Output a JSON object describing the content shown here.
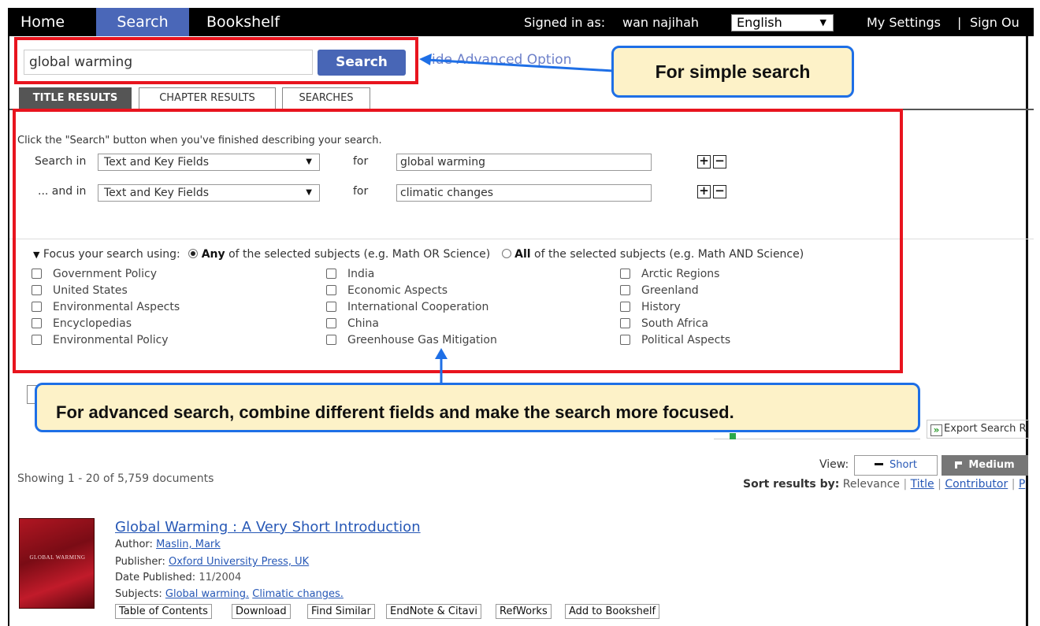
{
  "topnav": {
    "tabs": [
      "Home",
      "Search",
      "Bookshelf"
    ],
    "signed_in_label": "Signed in as:",
    "user": "wan najihah",
    "language": "English",
    "settings": "My Settings",
    "separator": "|",
    "signout": "Sign Ou"
  },
  "simple_search": {
    "value": "global warming",
    "button": "Search",
    "advanced_link": "ide Advanced Option"
  },
  "callouts": {
    "simple": "For simple search",
    "advanced": "For advanced search, combine different fields and make the search more focused."
  },
  "result_tabs": [
    "TITLE RESULTS",
    "CHAPTER RESULTS",
    "SEARCHES"
  ],
  "advanced": {
    "instruction": "Click the \"Search\" button when you've finished describing your search.",
    "rows": [
      {
        "label": "Search in",
        "field": "Text and Key Fields",
        "for": "for",
        "value": "global warming"
      },
      {
        "label": "... and in",
        "field": "Text and Key Fields",
        "for": "for",
        "value": "climatic changes"
      }
    ],
    "focus": {
      "label": "Focus your search using:",
      "any_bold": "Any",
      "any_rest": "of the selected subjects (e.g. Math OR Science)",
      "all_bold": "All",
      "all_rest": "of the selected subjects (e.g. Math AND Science)"
    },
    "subjects": [
      [
        "Government Policy",
        "United States",
        "Environmental Aspects",
        "Encyclopedias",
        "Environmental Policy"
      ],
      [
        "India",
        "Economic Aspects",
        "International Cooperation",
        "China",
        "Greenhouse Gas Mitigation"
      ],
      [
        "Arctic Regions",
        "Greenland",
        "History",
        "South Africa",
        "Political Aspects"
      ]
    ]
  },
  "results": {
    "export": "Export Search R",
    "view_label": "View:",
    "view_short": "Short",
    "view_medium": "Medium",
    "showing": "Showing 1 - 20 of 5,759 documents",
    "sort_label": "Sort results by:",
    "sort_relevance": "Relevance",
    "sort_title": "Title",
    "sort_contributor": "Contributor",
    "sort_more": "P",
    "sep": "|",
    "item": {
      "title": "Global Warming : A Very Short Introduction",
      "cover_text": "GLOBAL WARMING",
      "author_label": "Author:",
      "author": "Maslin, Mark",
      "publisher_label": "Publisher:",
      "publisher": "Oxford University Press, UK",
      "date_label": "Date Published:",
      "date": "11/2004",
      "subjects_label": "Subjects:",
      "subject_1": "Global warming.",
      "subject_2": "Climatic changes.",
      "actions": [
        "Table of Contents",
        "Download",
        "Find Similar",
        "EndNote & Citavi",
        "RefWorks",
        "Add to Bookshelf"
      ]
    }
  }
}
